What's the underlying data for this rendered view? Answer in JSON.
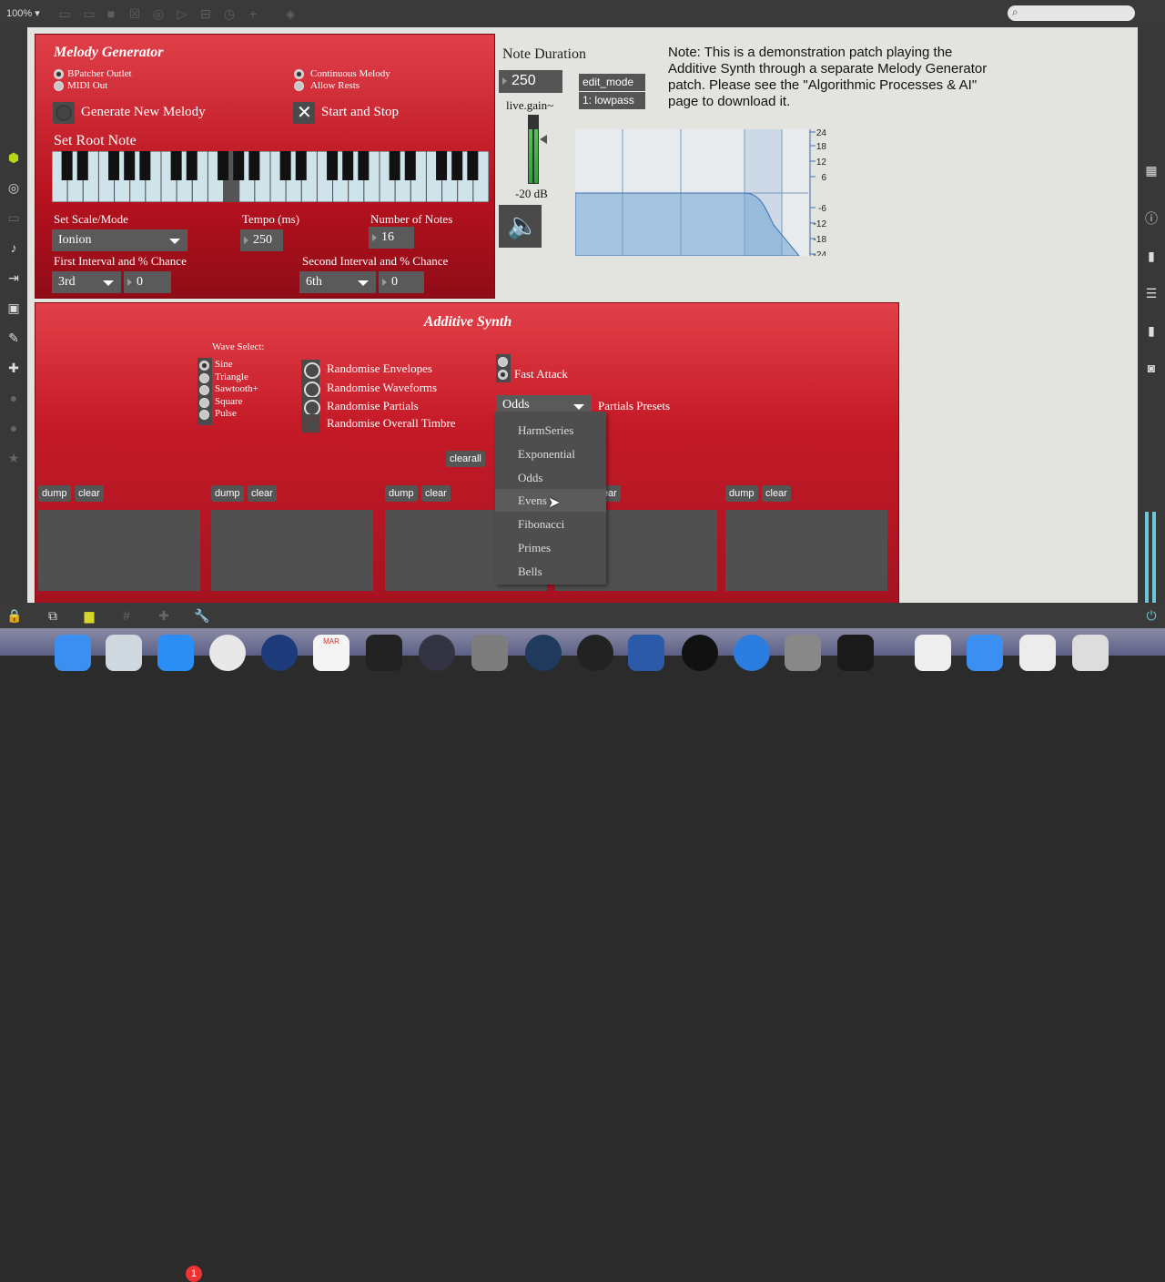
{
  "toolbar": {
    "zoom": "100% ▾"
  },
  "melody": {
    "title": "Melody Generator",
    "radios_left": [
      {
        "label": "BPatcher Outlet",
        "on": true
      },
      {
        "label": "MIDI Out",
        "on": false
      }
    ],
    "radios_right": [
      {
        "label": "Continuous Melody",
        "on": true
      },
      {
        "label": "Allow Rests",
        "on": false
      }
    ],
    "generate_label": "Generate New Melody",
    "start_stop_label": "Start and Stop",
    "root_note_label": "Set Root Note",
    "scale_label": "Set Scale/Mode",
    "scale_value": "Ionion",
    "tempo_label": "Tempo (ms)",
    "tempo_value": "250",
    "notes_label": "Number of Notes",
    "notes_value": "16",
    "first_interval_label": "First Interval and % Chance",
    "first_interval_value": "3rd",
    "first_chance": "0",
    "second_interval_label": "Second Interval and % Chance",
    "second_interval_value": "6th",
    "second_chance": "0"
  },
  "duration": {
    "label": "Note Duration",
    "value": "250",
    "gain_label": "live.gain~",
    "gain_db": "-20 dB",
    "edit_mode": "edit_mode",
    "filter_mode": "1: lowpass"
  },
  "filter_graph": {
    "db_labels": [
      "24",
      "18",
      "12",
      "6",
      "-6",
      "-12",
      "-18",
      "-24"
    ]
  },
  "note": "Note: This is a demonstration patch playing the Additive Synth through a separate Melody Generator patch. Please see the \"Algorithmic Processes & AI\" page to download it.",
  "synth": {
    "title": "Additive Synth",
    "wave_select_label": "Wave Select:",
    "waves": [
      {
        "label": "Sine",
        "on": true
      },
      {
        "label": "Triangle",
        "on": false
      },
      {
        "label": "Sawtooth+",
        "on": false
      },
      {
        "label": "Square",
        "on": false
      },
      {
        "label": "Pulse",
        "on": false
      }
    ],
    "randomise": [
      "Randomise Envelopes",
      "Randomise Waveforms",
      "Randomise Partials",
      "Randomise Overall Timbre"
    ],
    "fast_attack_label": "Fast Attack",
    "partials_value": "Odds",
    "partials_label": "Partials Presets",
    "clearall": "clearall",
    "dump": "dump",
    "clear": "clear",
    "dropdown": [
      "HarmSeries",
      "Exponential",
      "Odds",
      "Evens",
      "Fibonacci",
      "Primes",
      "Bells"
    ],
    "dropdown_highlight": 3
  },
  "dock": {
    "calendar_month": "MAR",
    "badge": "1"
  },
  "colors": {
    "panel_red": "#c51a27",
    "canvas": "#e3e3e0",
    "dark_ui": "#3a3a3a"
  }
}
